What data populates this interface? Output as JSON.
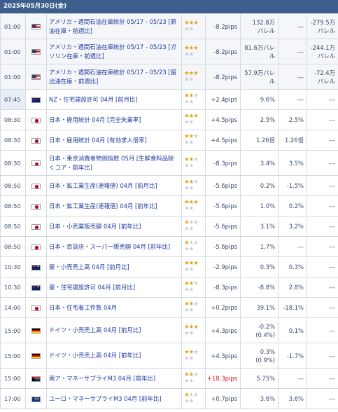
{
  "date": "2025年05月30日(金)",
  "events": [
    {
      "time": "01:00",
      "flag": "us",
      "name": "アメリカ・週間石油在庫統計 05/17 - 05/23 [原油在庫・前週比]",
      "stars": 3,
      "pips": "-8.2pips",
      "pips_up": false,
      "prev": [
        "132.8万",
        "バレル"
      ],
      "fcst": "---",
      "act": [
        "-279.5万",
        "バレル"
      ],
      "h": "r3",
      "state": "past"
    },
    {
      "time": "01:00",
      "flag": "us",
      "name": "アメリカ・週間石油在庫統計 05/17 - 05/23 [ガソリン在庫・前週比]",
      "stars": 3,
      "pips": "-8.2pips",
      "pips_up": false,
      "prev": [
        "81.6万バレル"
      ],
      "fcst": "---",
      "act": [
        "-244.1万",
        "バレル"
      ],
      "h": "r3",
      "state": "past"
    },
    {
      "time": "01:00",
      "flag": "us",
      "name": "アメリカ・週間石油在庫統計 05/17 - 05/23 [留出油在庫・前週比]",
      "stars": 3,
      "pips": "-8.2pips",
      "pips_up": false,
      "prev": [
        "57.9万バレル"
      ],
      "fcst": "---",
      "act": [
        "-72.4万",
        "バレル"
      ],
      "h": "r3",
      "state": "past"
    },
    {
      "time": "07:45",
      "flag": "nz",
      "name": "NZ・住宅建設許可 04月 [前月比]",
      "stars": 2,
      "pips": "+2.4pips",
      "pips_up": false,
      "prev": [
        "9.6%"
      ],
      "fcst": "---",
      "act": [
        "---"
      ],
      "h": "",
      "state": "today"
    },
    {
      "time": "08:30",
      "flag": "jp",
      "name": "日本・雇用統計 04月 [完全失業率]",
      "stars": 3,
      "pips": "+4.5pips",
      "pips_up": false,
      "prev": [
        "2.5%"
      ],
      "fcst": "2.5%",
      "act": [
        "---"
      ],
      "h": "",
      "state": "future"
    },
    {
      "time": "08:30",
      "flag": "jp",
      "name": "日本・雇用統計 04月 [有効求人倍率]",
      "stars": 2,
      "pips": "+4.5pips",
      "pips_up": false,
      "prev": [
        "1.26倍"
      ],
      "fcst": "1.26倍",
      "act": [
        "---"
      ],
      "h": "",
      "state": "future"
    },
    {
      "time": "08:30",
      "flag": "jp",
      "name": "日本・東京消費者物価指数 05月 [生鮮食料品除くコア・前年比]",
      "stars": 2,
      "pips": "-8.3pips",
      "pips_up": false,
      "prev": [
        "3.4%"
      ],
      "fcst": "3.5%",
      "act": [
        "---"
      ],
      "h": "r3",
      "state": "future"
    },
    {
      "time": "08:50",
      "flag": "jp",
      "name": "日本・鉱工業生産(速報値) 04月 [前月比]",
      "stars": 2,
      "pips": "-5.6pips",
      "pips_up": false,
      "prev": [
        "0.2%"
      ],
      "fcst": "-1.5%",
      "act": [
        "---"
      ],
      "h": "",
      "state": "future"
    },
    {
      "time": "08:50",
      "flag": "jp",
      "name": "日本・鉱工業生産(速報値) 04月 [前年比]",
      "stars": 3,
      "pips": "-5.6pips",
      "pips_up": false,
      "prev": [
        "1.0%"
      ],
      "fcst": "0.2%",
      "act": [
        "---"
      ],
      "h": "",
      "state": "future"
    },
    {
      "time": "08:50",
      "flag": "jp",
      "name": "日本・小売業販売額 04月 [前年比]",
      "stars": 1,
      "pips": "-5.6pips",
      "pips_up": false,
      "prev": [
        "3.1%"
      ],
      "fcst": "3.2%",
      "act": [
        "---"
      ],
      "h": "",
      "state": "future"
    },
    {
      "time": "08:50",
      "flag": "jp",
      "name": "日本・百貨店・スーパー販売額 04月 [前年比]",
      "stars": 1,
      "pips": "-5.6pips",
      "pips_up": false,
      "prev": [
        "1.7%"
      ],
      "fcst": "---",
      "act": [
        "---"
      ],
      "h": "",
      "state": "future"
    },
    {
      "time": "10:30",
      "flag": "au",
      "name": "豪・小売売上高 04月 [前月比]",
      "stars": 3,
      "pips": "-2.9pips",
      "pips_up": false,
      "prev": [
        "0.3%"
      ],
      "fcst": "0.3%",
      "act": [
        "---"
      ],
      "h": "",
      "state": "future"
    },
    {
      "time": "10:30",
      "flag": "au",
      "name": "豪・住宅建設許可 04月 [前月比]",
      "stars": 2,
      "pips": "-8.3pips",
      "pips_up": false,
      "prev": [
        "-8.8%"
      ],
      "fcst": "2.8%",
      "act": [
        "---"
      ],
      "h": "",
      "state": "future"
    },
    {
      "time": "14:00",
      "flag": "jp",
      "name": "日本・住宅着工件数 04月",
      "stars": 2,
      "pips": "+0.2pips",
      "pips_up": false,
      "prev": [
        "39.1%"
      ],
      "fcst": "-18.1%",
      "act": [
        "---"
      ],
      "h": "",
      "state": "future"
    },
    {
      "time": "15:00",
      "flag": "de",
      "name": "ドイツ・小売売上高 04月 [前月比]",
      "stars": 3,
      "pips": "+4.3pips",
      "pips_up": false,
      "prev": [
        "-0.2%",
        "(0.4%)"
      ],
      "fcst": "0.1%",
      "act": [
        "---"
      ],
      "h": "r3",
      "state": "future"
    },
    {
      "time": "15:00",
      "flag": "de",
      "name": "ドイツ・小売売上高 04月 [前年比]",
      "stars": 2,
      "pips": "+4.3pips",
      "pips_up": false,
      "prev": [
        "0.3%",
        "(0.9%)"
      ],
      "fcst": "-1.7%",
      "act": [
        "---"
      ],
      "h": "r3",
      "state": "future"
    },
    {
      "time": "15:00",
      "flag": "za",
      "name": "南ア・マネーサプライM3 04月 [前年比]",
      "stars": 2,
      "pips": "+18.3pips",
      "pips_up": true,
      "prev": [
        "5.75%"
      ],
      "fcst": "---",
      "act": [
        "---"
      ],
      "h": "",
      "state": "future"
    },
    {
      "time": "17:00",
      "flag": "eu",
      "name": "ユーロ・マネーサプライM3 04月 [前年比]",
      "stars": 1,
      "pips": "+0.7pips",
      "pips_up": false,
      "prev": [
        "3.6%"
      ],
      "fcst": "3.6%",
      "act": [
        "---"
      ],
      "h": "",
      "state": "future"
    }
  ]
}
